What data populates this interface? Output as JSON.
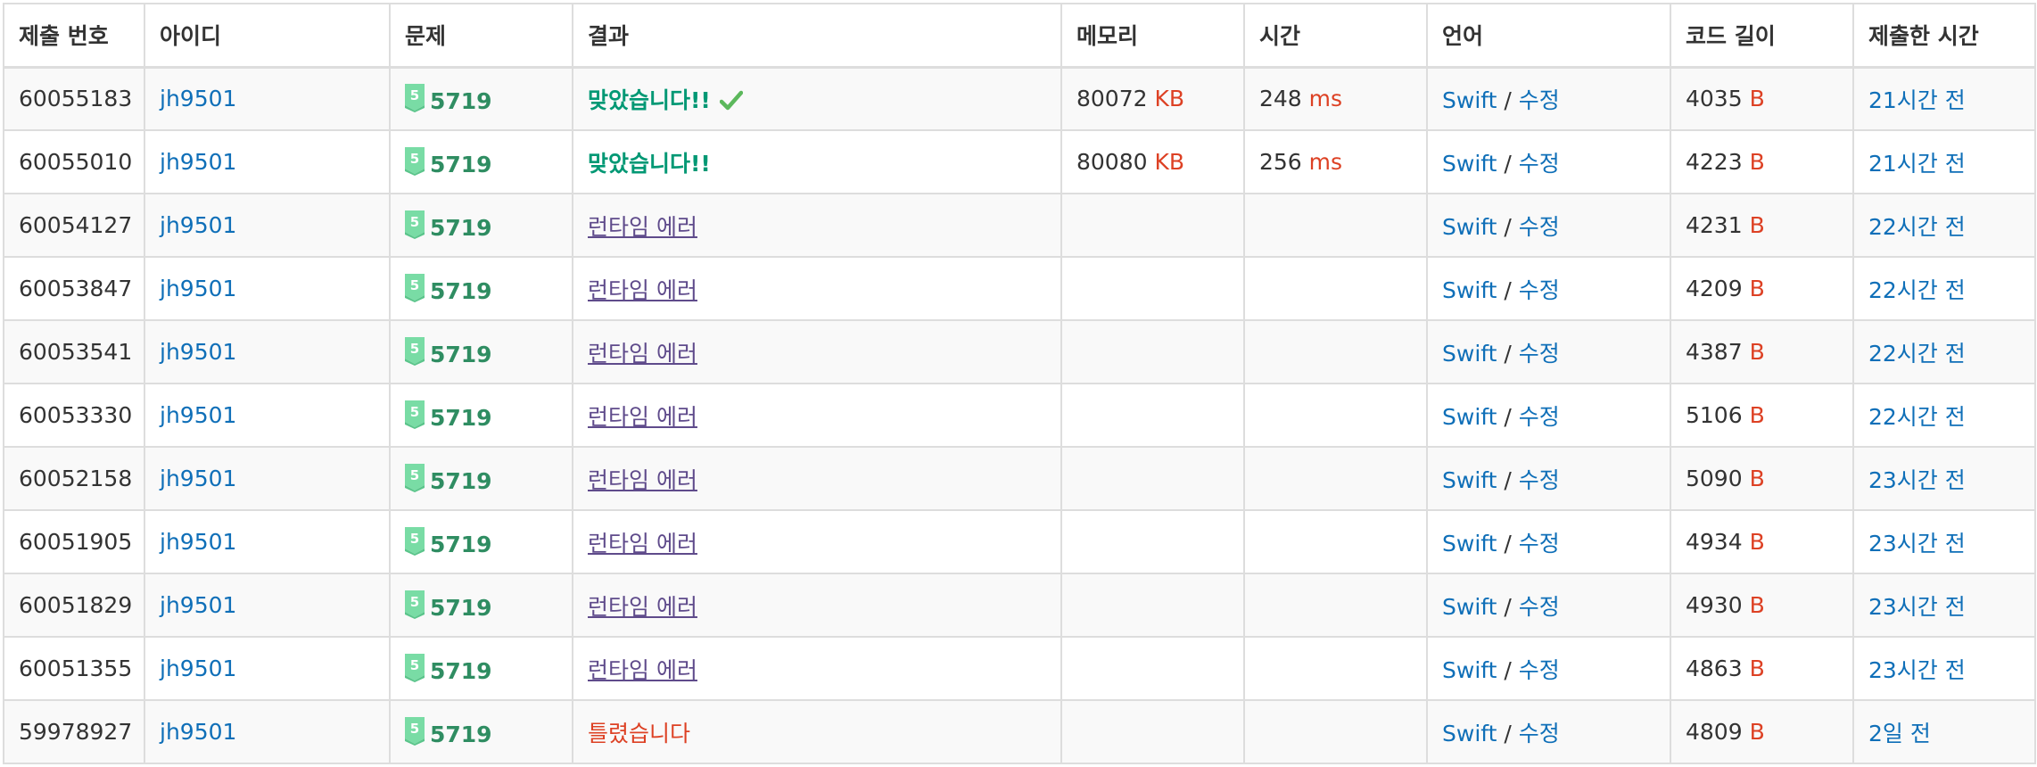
{
  "columns": [
    "제출 번호",
    "아이디",
    "문제",
    "결과",
    "메모리",
    "시간",
    "언어",
    "코드 길이",
    "제출한 시간"
  ],
  "colors": {
    "link": "#0f6fb8",
    "accepted": "#009874",
    "runtime_error": "#5f4b8b",
    "wrong": "#dd4124",
    "unit": "#dd4124",
    "problem": "#2f8d62",
    "tier_badge": "#79dca5"
  },
  "icons": {
    "tier": "gold-tier-5-icon",
    "check": "checkmark-icon"
  },
  "rows": [
    {
      "id": "60055183",
      "user": "jh9501",
      "tier": "5",
      "problem": "5719",
      "result": "맞았습니다!!",
      "result_type": "ac",
      "check": true,
      "memory": "80072",
      "memory_unit": "KB",
      "time": "248",
      "time_unit": "ms",
      "lang": "Swift",
      "sep": "/",
      "edit": "수정",
      "code_len": "4035",
      "code_unit": "B",
      "submitted": "21시간 전"
    },
    {
      "id": "60055010",
      "user": "jh9501",
      "tier": "5",
      "problem": "5719",
      "result": "맞았습니다!!",
      "result_type": "ac",
      "check": false,
      "memory": "80080",
      "memory_unit": "KB",
      "time": "256",
      "time_unit": "ms",
      "lang": "Swift",
      "sep": "/",
      "edit": "수정",
      "code_len": "4223",
      "code_unit": "B",
      "submitted": "21시간 전"
    },
    {
      "id": "60054127",
      "user": "jh9501",
      "tier": "5",
      "problem": "5719",
      "result": "런타임 에러",
      "result_type": "rte",
      "check": false,
      "memory": "",
      "memory_unit": "",
      "time": "",
      "time_unit": "",
      "lang": "Swift",
      "sep": "/",
      "edit": "수정",
      "code_len": "4231",
      "code_unit": "B",
      "submitted": "22시간 전"
    },
    {
      "id": "60053847",
      "user": "jh9501",
      "tier": "5",
      "problem": "5719",
      "result": "런타임 에러",
      "result_type": "rte",
      "check": false,
      "memory": "",
      "memory_unit": "",
      "time": "",
      "time_unit": "",
      "lang": "Swift",
      "sep": "/",
      "edit": "수정",
      "code_len": "4209",
      "code_unit": "B",
      "submitted": "22시간 전"
    },
    {
      "id": "60053541",
      "user": "jh9501",
      "tier": "5",
      "problem": "5719",
      "result": "런타임 에러",
      "result_type": "rte",
      "check": false,
      "memory": "",
      "memory_unit": "",
      "time": "",
      "time_unit": "",
      "lang": "Swift",
      "sep": "/",
      "edit": "수정",
      "code_len": "4387",
      "code_unit": "B",
      "submitted": "22시간 전"
    },
    {
      "id": "60053330",
      "user": "jh9501",
      "tier": "5",
      "problem": "5719",
      "result": "런타임 에러",
      "result_type": "rte",
      "check": false,
      "memory": "",
      "memory_unit": "",
      "time": "",
      "time_unit": "",
      "lang": "Swift",
      "sep": "/",
      "edit": "수정",
      "code_len": "5106",
      "code_unit": "B",
      "submitted": "22시간 전"
    },
    {
      "id": "60052158",
      "user": "jh9501",
      "tier": "5",
      "problem": "5719",
      "result": "런타임 에러",
      "result_type": "rte",
      "check": false,
      "memory": "",
      "memory_unit": "",
      "time": "",
      "time_unit": "",
      "lang": "Swift",
      "sep": "/",
      "edit": "수정",
      "code_len": "5090",
      "code_unit": "B",
      "submitted": "23시간 전"
    },
    {
      "id": "60051905",
      "user": "jh9501",
      "tier": "5",
      "problem": "5719",
      "result": "런타임 에러",
      "result_type": "rte",
      "check": false,
      "memory": "",
      "memory_unit": "",
      "time": "",
      "time_unit": "",
      "lang": "Swift",
      "sep": "/",
      "edit": "수정",
      "code_len": "4934",
      "code_unit": "B",
      "submitted": "23시간 전"
    },
    {
      "id": "60051829",
      "user": "jh9501",
      "tier": "5",
      "problem": "5719",
      "result": "런타임 에러",
      "result_type": "rte",
      "check": false,
      "memory": "",
      "memory_unit": "",
      "time": "",
      "time_unit": "",
      "lang": "Swift",
      "sep": "/",
      "edit": "수정",
      "code_len": "4930",
      "code_unit": "B",
      "submitted": "23시간 전"
    },
    {
      "id": "60051355",
      "user": "jh9501",
      "tier": "5",
      "problem": "5719",
      "result": "런타임 에러",
      "result_type": "rte",
      "check": false,
      "memory": "",
      "memory_unit": "",
      "time": "",
      "time_unit": "",
      "lang": "Swift",
      "sep": "/",
      "edit": "수정",
      "code_len": "4863",
      "code_unit": "B",
      "submitted": "23시간 전"
    },
    {
      "id": "59978927",
      "user": "jh9501",
      "tier": "5",
      "problem": "5719",
      "result": "틀렸습니다",
      "result_type": "wa",
      "check": false,
      "memory": "",
      "memory_unit": "",
      "time": "",
      "time_unit": "",
      "lang": "Swift",
      "sep": "/",
      "edit": "수정",
      "code_len": "4809",
      "code_unit": "B",
      "submitted": "2일 전"
    }
  ]
}
